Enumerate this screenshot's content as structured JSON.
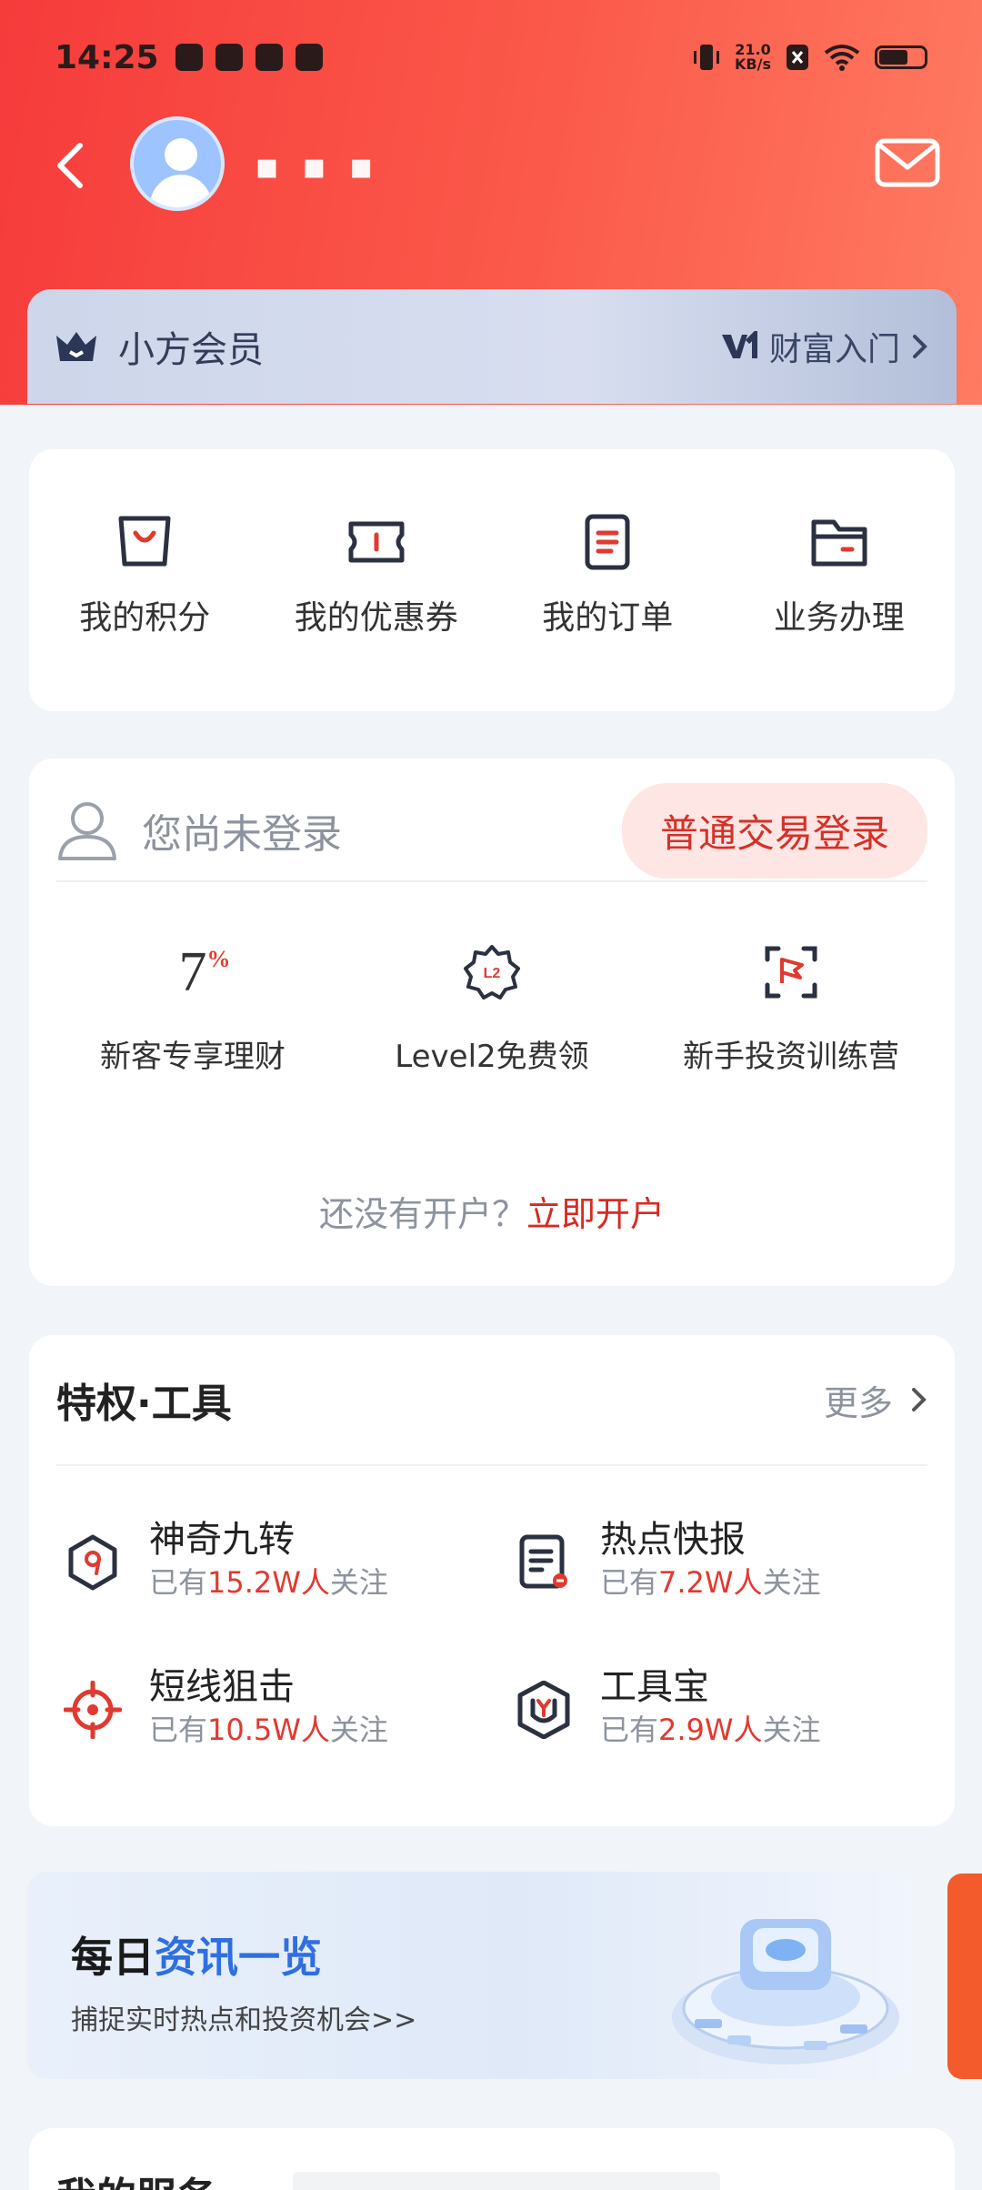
{
  "status_bar": {
    "time": "14:25",
    "net_speed_value": "21.0",
    "net_speed_unit": "KB/s"
  },
  "header": {
    "username_masked": "▪ ▪ ▪"
  },
  "member": {
    "title": "小方会员",
    "badge": "V1",
    "level_label": "财富入门"
  },
  "quick_entries": [
    {
      "label": "我的积分",
      "icon": "shopping-bag-icon"
    },
    {
      "label": "我的优惠券",
      "icon": "coupon-icon"
    },
    {
      "label": "我的订单",
      "icon": "order-icon"
    },
    {
      "label": "业务办理",
      "icon": "folder-icon"
    }
  ],
  "login_card": {
    "not_logged_in": "您尚未登录",
    "login_button": "普通交易登录",
    "features": [
      {
        "label": "新客专享理财",
        "big": "7",
        "sup": "%"
      },
      {
        "label": "Level2免费领",
        "icon_text": "L2"
      },
      {
        "label": "新手投资训练营"
      }
    ],
    "open_prompt": "还没有开户？",
    "open_link": "立即开户"
  },
  "tools": {
    "title": "特权·工具",
    "more": "更多",
    "items": [
      {
        "name": "神奇九转",
        "prefix": "已有",
        "count": "15.2W人",
        "suffix": "关注"
      },
      {
        "name": "热点快报",
        "prefix": "已有",
        "count": "7.2W人",
        "suffix": "关注"
      },
      {
        "name": "短线狙击",
        "prefix": "已有",
        "count": "10.5W人",
        "suffix": "关注"
      },
      {
        "name": "工具宝",
        "prefix": "已有",
        "count": "2.9W人",
        "suffix": "关注"
      }
    ]
  },
  "banner": {
    "title_a": "每日",
    "title_b": "资讯一览",
    "subtitle": "捕捉实时热点和投资机会>>"
  },
  "services": {
    "title": "我的服务"
  },
  "colors": {
    "header_red": "#f63b3b",
    "accent_red": "#e03a30",
    "link_blue": "#2f6fe0"
  }
}
